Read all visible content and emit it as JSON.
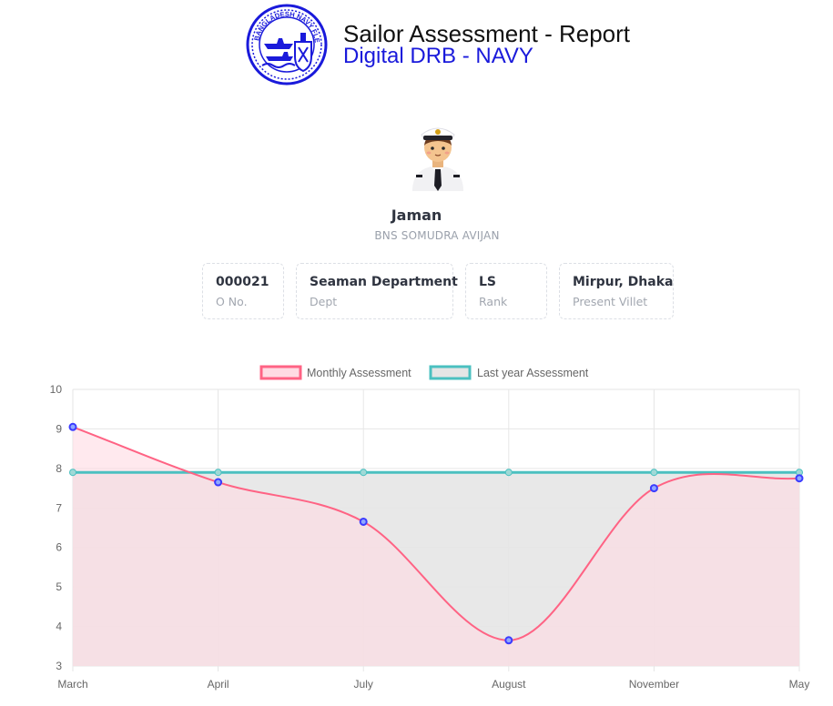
{
  "header": {
    "title": "Sailor Assessment - Report",
    "subtitle": "Digital DRB - NAVY",
    "logo_text": "BANGLADESH NAVY FLEET"
  },
  "profile": {
    "name": "Jaman",
    "ship": "BNS SOMUDRA AVIJAN"
  },
  "cards": [
    {
      "value": "000021",
      "label": "O No."
    },
    {
      "value": "Seaman Department",
      "label": "Dept"
    },
    {
      "value": "LS",
      "label": "Rank"
    },
    {
      "value": "Mirpur, Dhaka",
      "label": "Present Villet"
    }
  ],
  "colors": {
    "title": "#111111",
    "subtitle": "#1a1adb",
    "monthly_line": "#ff6384",
    "monthly_fill": "#ffdbe3",
    "last_year_line": "#4bc0c0",
    "last_year_fill": "#e5e5e5",
    "point": "#3b3bff"
  },
  "chart_data": {
    "type": "line",
    "categories": [
      "March",
      "April",
      "July",
      "August",
      "November",
      "May"
    ],
    "series": [
      {
        "name": "Monthly Assessment",
        "values": [
          9.05,
          7.65,
          6.65,
          3.65,
          7.5,
          7.75
        ]
      },
      {
        "name": "Last year Assessment",
        "values": [
          7.9,
          7.9,
          7.9,
          7.9,
          7.9,
          7.9
        ]
      }
    ],
    "ylim": [
      3,
      10
    ],
    "yticks": [
      "3",
      "4",
      "5",
      "6",
      "7",
      "8",
      "9",
      "10"
    ],
    "grid": true,
    "legend": "top-center"
  }
}
